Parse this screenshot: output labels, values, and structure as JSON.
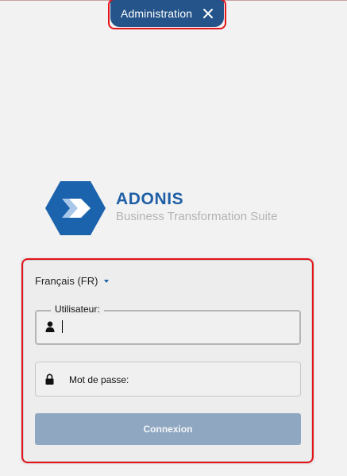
{
  "tab": {
    "label": "Administration",
    "close_icon": "close-icon"
  },
  "brand": {
    "name": "ADONIS",
    "subtitle": "Business Transformation Suite",
    "logo_icon": "adonis-hexagon-arrow-logo",
    "colors": {
      "logo": "#1b63ad",
      "name": "#1f5fa5",
      "subtitle": "#b3b3b3"
    }
  },
  "login": {
    "language": "Français (FR)",
    "username_label": "Utilisateur:",
    "username_value": "",
    "password_label": "Mot de passe:",
    "submit_label": "Connexion",
    "icons": {
      "user": "user-icon",
      "password": "lock-icon",
      "language_caret": "caret-down-icon"
    },
    "colors": {
      "submit_button": "#8fa7c1",
      "tab": "#245489",
      "highlight_outline": "#e3141b"
    }
  }
}
